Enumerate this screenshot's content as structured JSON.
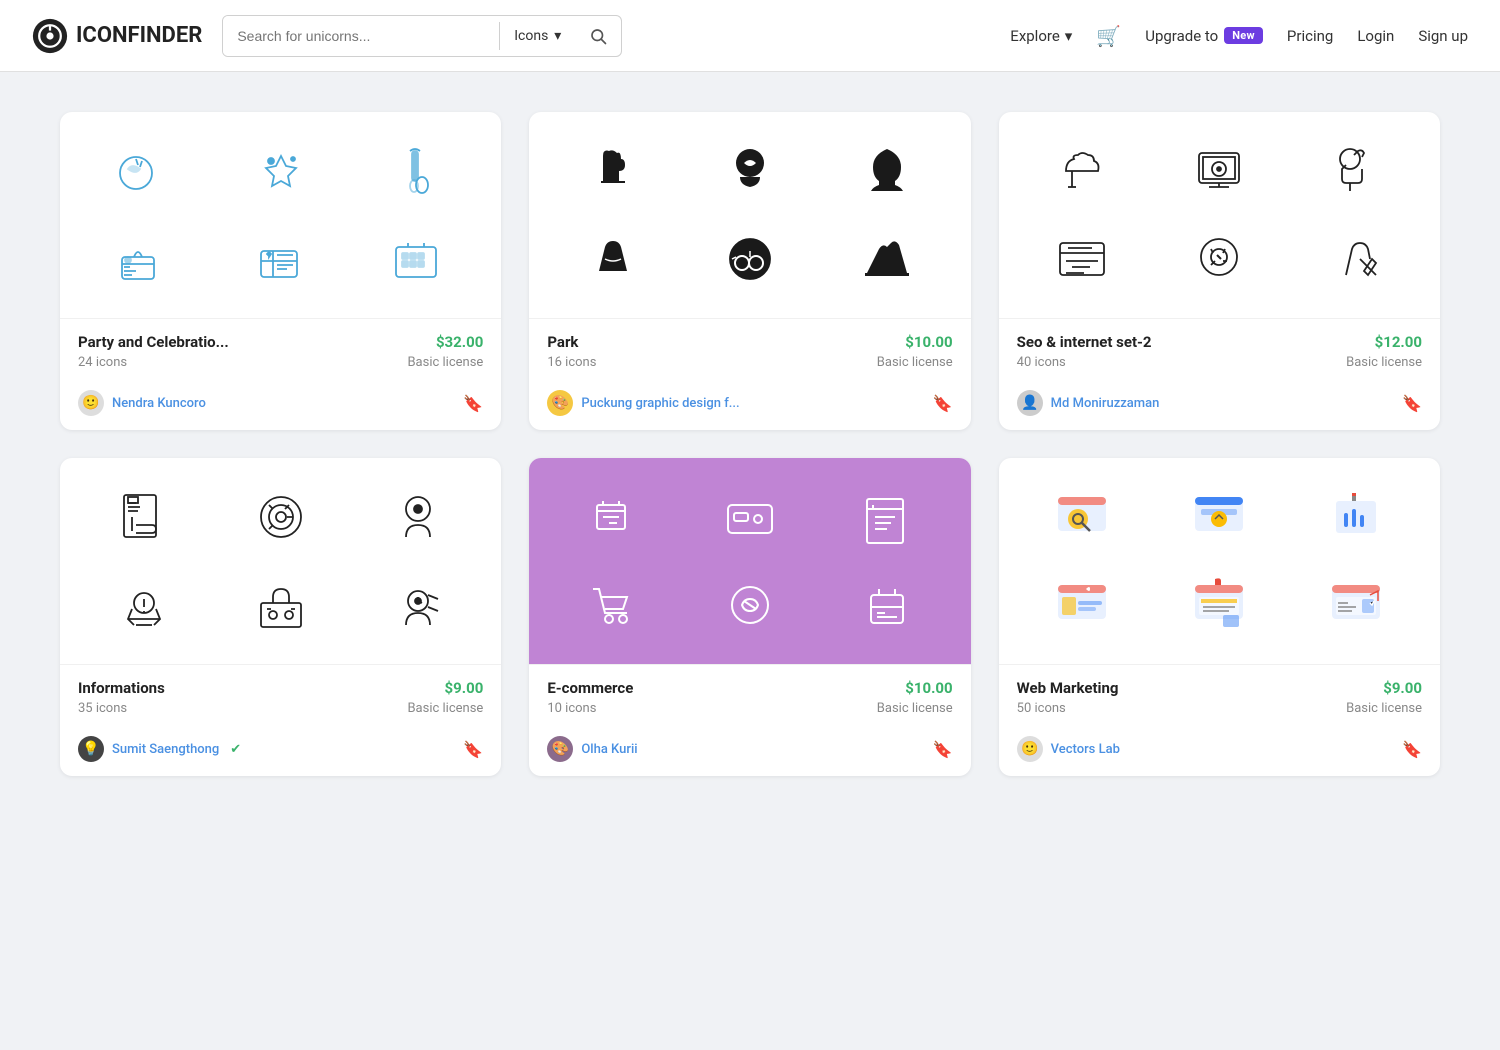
{
  "header": {
    "logo_text": "ICONFINDER",
    "search_placeholder": "Search for unicorns...",
    "search_type_label": "Icons",
    "explore_label": "Explore",
    "cart_label": "cart",
    "upgrade_label": "Upgrade to",
    "new_badge": "New",
    "pricing_label": "Pricing",
    "login_label": "Login",
    "signup_label": "Sign up"
  },
  "cards": [
    {
      "id": "party",
      "title": "Party and Celebratio...",
      "count": "24 icons",
      "price": "$32.00",
      "license": "Basic license",
      "author": "Nendra Kuncoro",
      "bg": "white"
    },
    {
      "id": "park",
      "title": "Park",
      "count": "16 icons",
      "price": "$10.00",
      "license": "Basic license",
      "author": "Puckung graphic design f...",
      "bg": "white"
    },
    {
      "id": "seo",
      "title": "Seo & internet set-2",
      "count": "40 icons",
      "price": "$12.00",
      "license": "Basic license",
      "author": "Md Moniruzzaman",
      "bg": "white"
    },
    {
      "id": "info",
      "title": "Informations",
      "count": "35 icons",
      "price": "$9.00",
      "license": "Basic license",
      "author": "Sumit Saengthong",
      "verified": true,
      "bg": "white"
    },
    {
      "id": "ecommerce",
      "title": "E-commerce",
      "count": "10 icons",
      "price": "$10.00",
      "license": "Basic license",
      "author": "Olha Kurii",
      "bg": "purple"
    },
    {
      "id": "webmarketing",
      "title": "Web Marketing",
      "count": "50 icons",
      "price": "$9.00",
      "license": "Basic license",
      "author": "Vectors Lab",
      "bg": "white"
    }
  ]
}
